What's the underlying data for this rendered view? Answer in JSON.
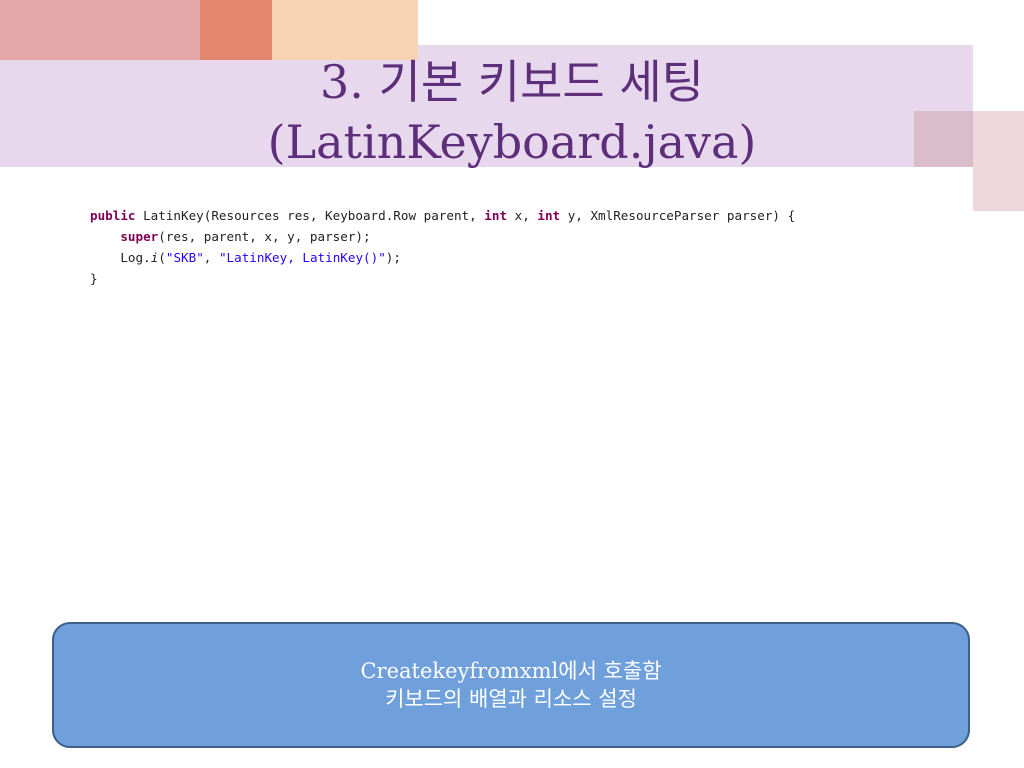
{
  "slide": {
    "title_line1": "3. 기본 키보드 세팅",
    "title_line2": "(LatinKeyboard.java)"
  },
  "code": {
    "line1": {
      "kw_public": "public",
      "t1": " LatinKey(Resources res, Keyboard.Row parent, ",
      "kw_int1": "int",
      "t2": " x, ",
      "kw_int2": "int",
      "t3": " y, XmlResourceParser parser) {"
    },
    "line2": {
      "indent": "    ",
      "kw_super": "super",
      "t1": "(res, parent, x, y, parser);"
    },
    "line3": {
      "indent": "    ",
      "t1": "Log.",
      "method_i": "i",
      "t2": "(",
      "str1": "\"SKB\"",
      "t3": ", ",
      "str2": "\"LatinKey, LatinKey()\"",
      "t4": ");"
    },
    "line4": "}"
  },
  "note": {
    "line1": "Createkeyfromxml에서 호출함",
    "line2": "키보드의 배열과 리소스 설정"
  },
  "colors": {
    "title": "#5d2f7a",
    "band": "#e8d8ee",
    "note_fill": "#6fa0dc",
    "note_border": "#3c5f87"
  }
}
